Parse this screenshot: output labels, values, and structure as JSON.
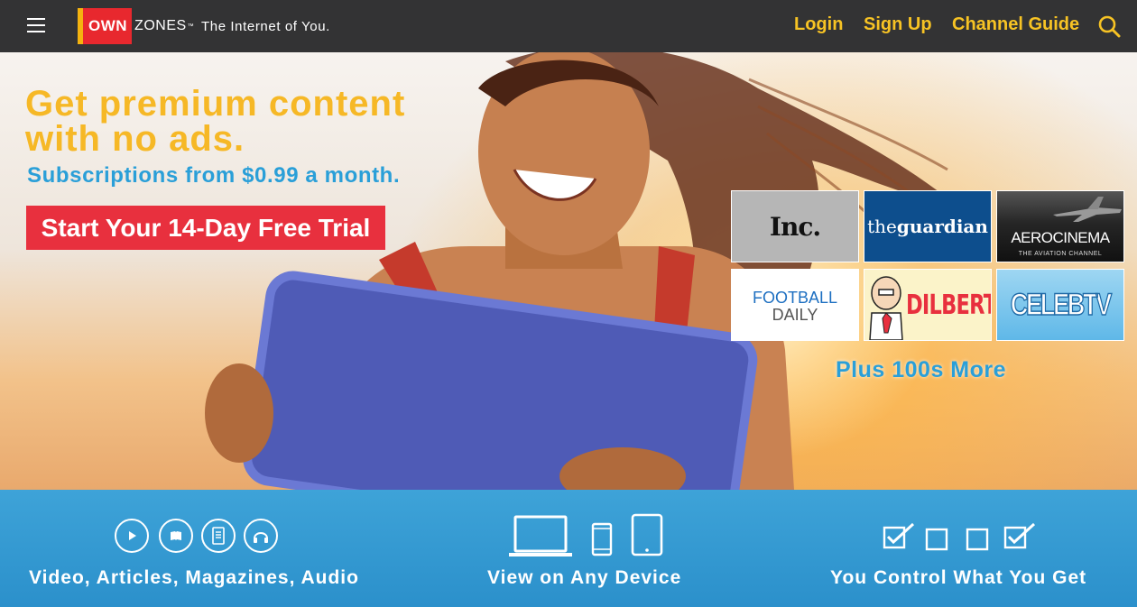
{
  "header": {
    "logo_own": "OWN",
    "logo_zones": "ZONES",
    "logo_tm": "™",
    "tagline": "The Internet of You.",
    "nav": {
      "login": "Login",
      "signup": "Sign Up",
      "channel_guide": "Channel Guide"
    },
    "icons": [
      "menu-icon",
      "search-icon"
    ],
    "accent": "#f7c324"
  },
  "hero": {
    "headline_line1": "Get premium content",
    "headline_line2": "with no ads.",
    "subhead": "Subscriptions from $0.99 a month.",
    "cta": "Start Your 14-Day Free Trial",
    "channels": {
      "inc": "Inc.",
      "guardian_the": "the",
      "guardian_name": "guardian",
      "aero_name": "AEROCINEMA",
      "aero_sub": "THE AVIATION CHANNEL",
      "football_1": "FOOTBALL",
      "football_2": "DAILY",
      "dilbert": "DILBERT",
      "celeb": "CELEBTV"
    },
    "plus_more": "Plus 100s More",
    "colors": {
      "headline": "#f6b826",
      "subhead": "#2a9fd8",
      "cta_bg": "#e8303e"
    }
  },
  "features": {
    "items": [
      {
        "label": "Video, Articles, Magazines, Audio",
        "icons": [
          "play-icon",
          "book-icon",
          "magazine-icon",
          "headphones-icon"
        ]
      },
      {
        "label": "View on Any Device",
        "icons": [
          "laptop-icon",
          "phone-icon",
          "tablet-icon"
        ]
      },
      {
        "label": "You Control What You Get",
        "icons": [
          "checked-box-icon",
          "empty-box-icon",
          "empty-box-icon",
          "checked-box-icon"
        ]
      }
    ],
    "strip_color": "#3ea3d8"
  }
}
